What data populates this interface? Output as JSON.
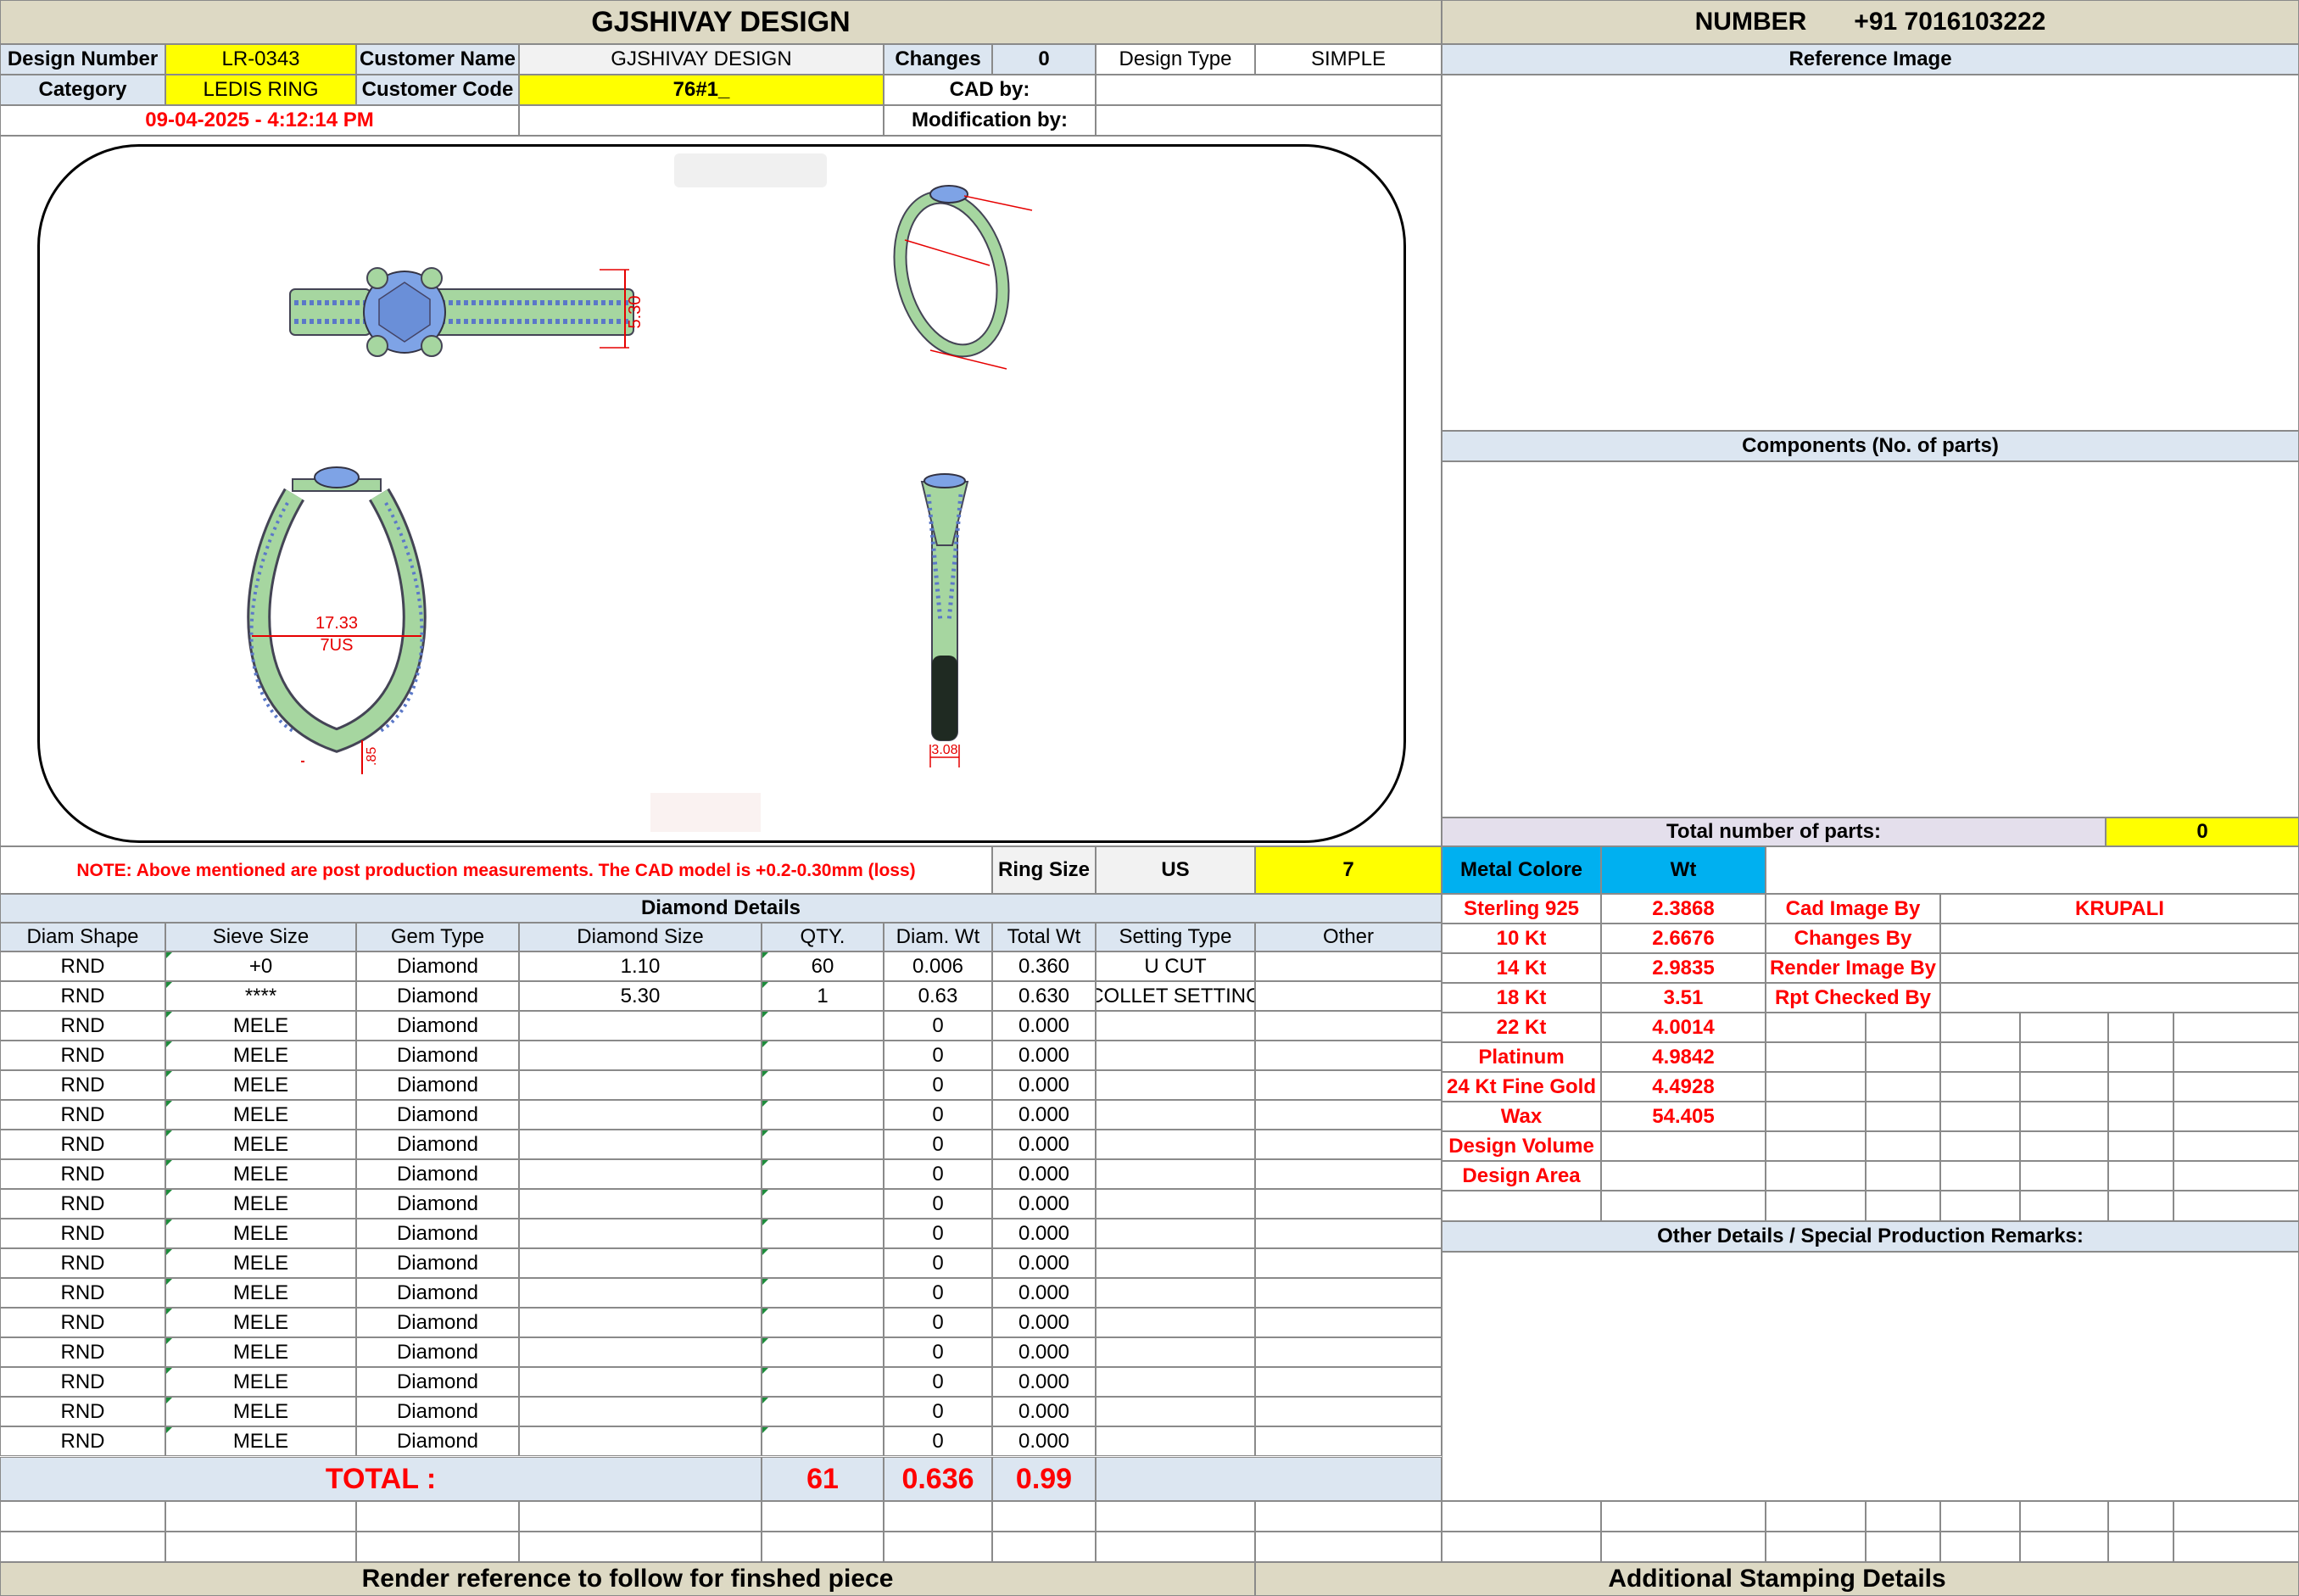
{
  "header": {
    "title": "GJSHIVAY DESIGN",
    "number_label": "NUMBER",
    "number_value": "+91 7016103222"
  },
  "info": {
    "design_number_label": "Design Number",
    "design_number": "LR-0343",
    "customer_name_label": "Customer Name",
    "customer_name": "GJSHIVAY DESIGN",
    "changes_label": "Changes",
    "changes": "0",
    "design_type_label": "Design Type",
    "design_type": "SIMPLE",
    "category_label": "Category",
    "category": "LEDIS RING",
    "customer_code_label": "Customer Code",
    "customer_code": "76#1_",
    "cad_by_label": "CAD by:",
    "datetime": "09-04-2025 - 4:12:14 PM",
    "modification_by_label": "Modification by:"
  },
  "drawing": {
    "dims": [
      "5.30",
      "17.33",
      "7US",
      ".85",
      "3.08",
      "17.33",
      "7US"
    ]
  },
  "right_panel": {
    "reference_image": "Reference Image",
    "components": "Components (No. of parts)",
    "total_parts_label": "Total number of parts:",
    "total_parts": "0",
    "other_details": "Other Details / Special Production Remarks:"
  },
  "note": {
    "text": "NOTE: Above mentioned are post production measurements. The CAD model is +0.2-0.30mm (loss)",
    "ring_size_label": "Ring Size",
    "ring_size_unit": "US",
    "ring_size": "7"
  },
  "diamond_details": {
    "title": "Diamond Details",
    "columns": [
      "Diam Shape",
      "Sieve Size",
      "Gem Type",
      "Diamond Size",
      "QTY.",
      "Diam. Wt",
      "Total Wt",
      "Setting Type",
      "Other"
    ],
    "rows": [
      [
        "RND",
        "+0",
        "Diamond",
        "1.10",
        "60",
        "0.006",
        "0.360",
        "U CUT",
        ""
      ],
      [
        "RND",
        "****",
        "Diamond",
        "5.30",
        "1",
        "0.63",
        "0.630",
        "COLLET SETTING",
        ""
      ],
      [
        "RND",
        "MELE",
        "Diamond",
        "",
        "",
        "0",
        "0.000",
        "",
        ""
      ],
      [
        "RND",
        "MELE",
        "Diamond",
        "",
        "",
        "0",
        "0.000",
        "",
        ""
      ],
      [
        "RND",
        "MELE",
        "Diamond",
        "",
        "",
        "0",
        "0.000",
        "",
        ""
      ],
      [
        "RND",
        "MELE",
        "Diamond",
        "",
        "",
        "0",
        "0.000",
        "",
        ""
      ],
      [
        "RND",
        "MELE",
        "Diamond",
        "",
        "",
        "0",
        "0.000",
        "",
        ""
      ],
      [
        "RND",
        "MELE",
        "Diamond",
        "",
        "",
        "0",
        "0.000",
        "",
        ""
      ],
      [
        "RND",
        "MELE",
        "Diamond",
        "",
        "",
        "0",
        "0.000",
        "",
        ""
      ],
      [
        "RND",
        "MELE",
        "Diamond",
        "",
        "",
        "0",
        "0.000",
        "",
        ""
      ],
      [
        "RND",
        "MELE",
        "Diamond",
        "",
        "",
        "0",
        "0.000",
        "",
        ""
      ],
      [
        "RND",
        "MELE",
        "Diamond",
        "",
        "",
        "0",
        "0.000",
        "",
        ""
      ],
      [
        "RND",
        "MELE",
        "Diamond",
        "",
        "",
        "0",
        "0.000",
        "",
        ""
      ],
      [
        "RND",
        "MELE",
        "Diamond",
        "",
        "",
        "0",
        "0.000",
        "",
        ""
      ],
      [
        "RND",
        "MELE",
        "Diamond",
        "",
        "",
        "0",
        "0.000",
        "",
        ""
      ],
      [
        "RND",
        "MELE",
        "Diamond",
        "",
        "",
        "0",
        "0.000",
        "",
        ""
      ],
      [
        "RND",
        "MELE",
        "Diamond",
        "",
        "",
        "0",
        "0.000",
        "",
        ""
      ]
    ],
    "total_label": "TOTAL :",
    "total_qty": "61",
    "total_diam_wt": "0.636",
    "total_wt": "0.99"
  },
  "metal": {
    "label": "Metal Colore",
    "wt_label": "Wt",
    "rows": [
      [
        "Sterling 925",
        "2.3868"
      ],
      [
        "10 Kt",
        "2.6676"
      ],
      [
        "14 Kt",
        "2.9835"
      ],
      [
        "18 Kt",
        "3.51"
      ],
      [
        "22 Kt",
        "4.0014"
      ],
      [
        "Platinum",
        "4.9842"
      ],
      [
        "24 Kt Fine Gold",
        "4.4928"
      ],
      [
        "Wax",
        "54.405"
      ],
      [
        "Design Volume",
        ""
      ],
      [
        "Design Area",
        ""
      ]
    ]
  },
  "credits": {
    "rows": [
      [
        "Cad Image By",
        "KRUPALI"
      ],
      [
        "Changes By",
        ""
      ],
      [
        "Render Image By",
        ""
      ],
      [
        "Rpt Checked By",
        ""
      ]
    ]
  },
  "footer": {
    "left": "Render reference to follow for finshed piece",
    "right": "Additional Stamping Details"
  },
  "colors": {
    "header_bg": "#ddd9c4",
    "label_bg": "#dce6f1",
    "highlight": "#ffff00",
    "metal_header": "#00b0f0",
    "ring_body": "#a6d6a0",
    "stone": "#7ea3e6",
    "dimension": "#e60000"
  }
}
